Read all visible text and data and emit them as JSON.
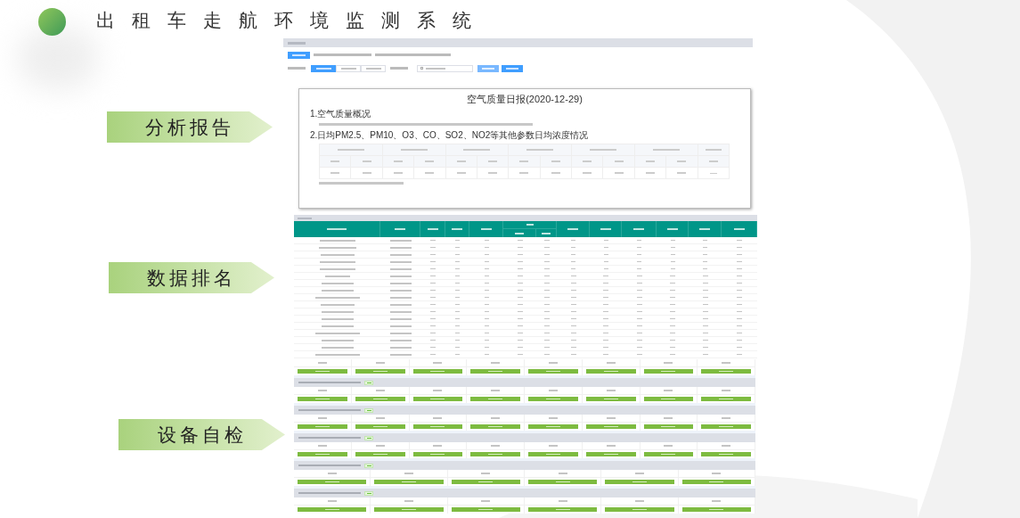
{
  "header": {
    "title": "出租车走航环境监测系统"
  },
  "sections": [
    {
      "label": "分析报告"
    },
    {
      "label": "数据排名"
    },
    {
      "label": "设备自检"
    }
  ],
  "daily_report": {
    "title": "空气质量日报(2020-12-29)",
    "section_1": "1.空气质量概况",
    "section_2": "2.日均PM2.5、PM10、O3、CO、SO2、NO2等其他参数日均浓度情况"
  }
}
